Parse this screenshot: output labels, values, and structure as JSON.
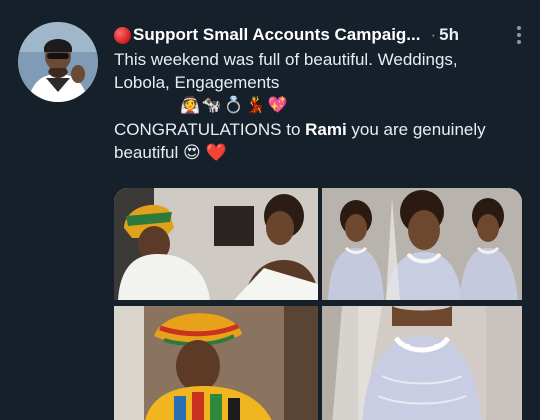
{
  "tweet": {
    "display_name": "Support Small Accounts Campaig...",
    "separator": "·",
    "time": "5h",
    "text_lines": [
      "This weekend was full of beautiful. Weddings,",
      "Lobola, Engagements"
    ],
    "emoji_line": "👰🐄💍💃💖",
    "congrats_prefix": "CONGRATULATIONS  to ",
    "congrats_name": "Rami",
    "congrats_suffix": " you are genuinely",
    "closing_line": "beautiful 😍 ❤️"
  },
  "colors": {
    "background": "#15202b",
    "text": "#e8edf1",
    "secondary": "#8899a6"
  },
  "icons": {
    "status": "red-circle-icon",
    "more": "more-vertical-icon"
  },
  "media": {
    "count": 4
  }
}
